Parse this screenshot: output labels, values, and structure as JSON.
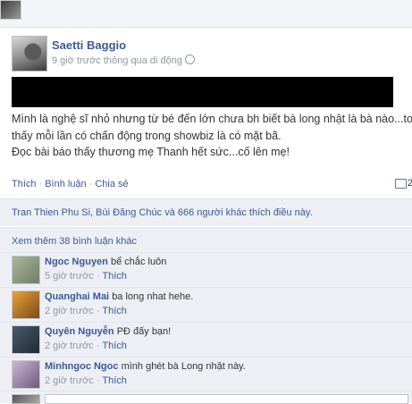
{
  "post": {
    "author": "Saetti Baggio",
    "meta": "9 giờ trước thông qua di động",
    "lines": [
      "Mình là nghệ sĩ nhỏ nhưng từ bé đến lớn chưa bh biết bà long nhật là bà nào...toàn",
      "thấy mỗi lần có chấn động trong showbiz là có mặt bã.",
      "Đọc bài báo thấy thương mẹ Thanh hết sức...cố lên mẹ!"
    ],
    "actions": {
      "like": "Thích",
      "comment": "Bình luận",
      "share": "Chia sẻ"
    },
    "comment_count": "2",
    "likes_text": "Tran Thien Phu Si, Bùi Đăng Chúc và 666 người khác thích điều này.",
    "more_comments": "Xem thêm 38 bình luận khác"
  },
  "comments": [
    {
      "name": "Ngoc Nguyen",
      "text": "bể chắc luôn",
      "time": "5 giờ trước",
      "like": "Thích"
    },
    {
      "name": "Quanghai Mai",
      "text": "ba long nhat hehe.",
      "time": "2 giờ trước",
      "like": "Thích"
    },
    {
      "name": "Quyên Nguyễn",
      "text": "PĐ đấy bạn!",
      "time": "2 giờ trước",
      "like": "Thích"
    },
    {
      "name": "Minhngoc Ngoc",
      "text": "mình ghét bà Long nhật này.",
      "time": "2 giờ trước",
      "like": "Thích"
    }
  ],
  "colors": {
    "link": "#3b5998",
    "panel": "#edeff4",
    "meta": "#9197a3"
  }
}
